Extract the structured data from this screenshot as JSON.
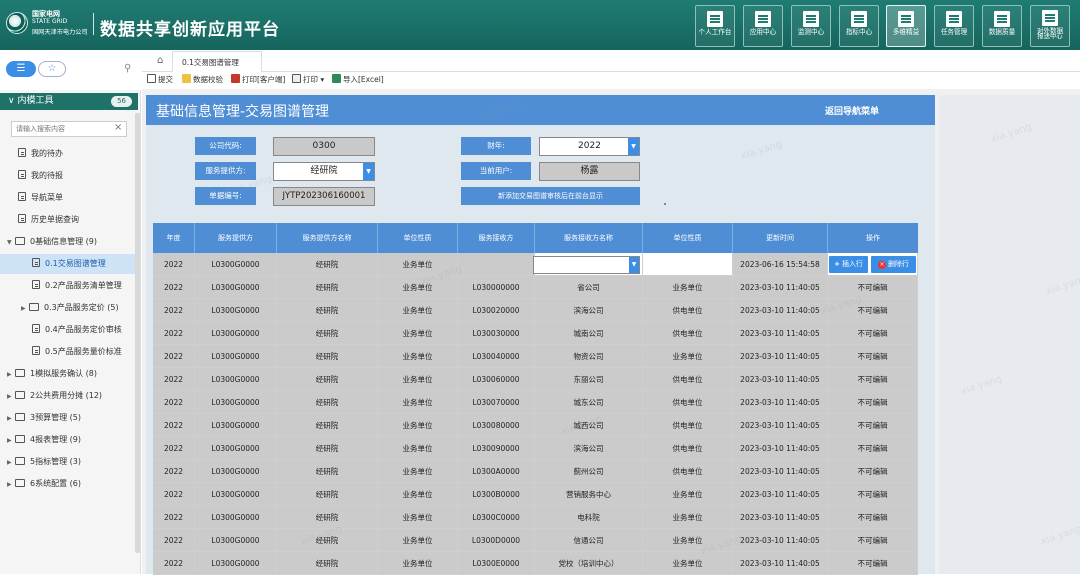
{
  "header": {
    "logo_line1": "国家电网",
    "logo_line2": "STATE GRID",
    "logo_line3": "国网天津市电力公司",
    "app_title": "数据共享创新应用平台",
    "nav": [
      {
        "label": "个人工作台"
      },
      {
        "label": "应用中心"
      },
      {
        "label": "监测中心"
      },
      {
        "label": "指标中心"
      },
      {
        "label": "多维精益",
        "active": true
      },
      {
        "label": "任务管理"
      },
      {
        "label": "数据质量"
      },
      {
        "label": "对外数据",
        "label2": "报送中心"
      }
    ]
  },
  "sidebar": {
    "section": "内模工具",
    "count": "56",
    "search_placeholder": "请输入搜索内容",
    "items": [
      {
        "label": "我的待办"
      },
      {
        "label": "我的待报"
      },
      {
        "label": "导航菜单"
      },
      {
        "label": "历史单据查询"
      },
      {
        "label": "0基础信息管理 (9)"
      },
      {
        "label": "0.1交易图谱管理",
        "selected": true
      },
      {
        "label": "0.2产品服务清单管理"
      },
      {
        "label": "0.3产品服务定价 (5)"
      },
      {
        "label": "0.4产品服务定价审核"
      },
      {
        "label": "0.5产品服务量价标准"
      },
      {
        "label": "1模拟服务确认 (8)"
      },
      {
        "label": "2公共费用分摊 (12)"
      },
      {
        "label": "3预算管理 (5)"
      },
      {
        "label": "4报表管理 (9)"
      },
      {
        "label": "5指标管理 (3)"
      },
      {
        "label": "6系统配置 (6)"
      }
    ]
  },
  "tabs": {
    "home_icon": "home-icon",
    "active_tab": "0.1交易图谱管理"
  },
  "toolbar": {
    "submit": "提交",
    "validate": "数据校验",
    "print_client": "打印[客户端]",
    "print": "打印",
    "import": "导入[Excel]"
  },
  "form": {
    "title": "基础信息管理-交易图谱管理",
    "back_label": "返回导航菜单",
    "company_code_label": "公司代码:",
    "company_code": "0300",
    "fiscal_year_label": "财年:",
    "fiscal_year": "2022",
    "provider_label": "服务提供方:",
    "provider": "经研院",
    "current_user_label": "当前用户:",
    "current_user": "杨露",
    "doc_no_label": "单据编号:",
    "doc_no": "JYTP202306160001",
    "notice": "新添加交易图谱审核后在前台显示"
  },
  "table": {
    "headers": [
      "年度",
      "服务提供方",
      "服务提供方名称",
      "单位性质",
      "服务接收方",
      "服务接收方名称",
      "单位性质",
      "更新时间",
      "操作"
    ],
    "insert_label": "插入行",
    "delete_label": "删除行",
    "rows": [
      [
        "2022",
        "L0300G0000",
        "经研院",
        "业务单位",
        "",
        "",
        "",
        "2023-06-16 15:54:58",
        ""
      ],
      [
        "2022",
        "L0300G0000",
        "经研院",
        "业务单位",
        "L030000000",
        "省公司",
        "业务单位",
        "2023-03-10 11:40:05",
        "不可编辑"
      ],
      [
        "2022",
        "L0300G0000",
        "经研院",
        "业务单位",
        "L030020000",
        "滨海公司",
        "供电单位",
        "2023-03-10 11:40:05",
        "不可编辑"
      ],
      [
        "2022",
        "L0300G0000",
        "经研院",
        "业务单位",
        "L030030000",
        "城南公司",
        "供电单位",
        "2023-03-10 11:40:05",
        "不可编辑"
      ],
      [
        "2022",
        "L0300G0000",
        "经研院",
        "业务单位",
        "L030040000",
        "物资公司",
        "业务单位",
        "2023-03-10 11:40:05",
        "不可编辑"
      ],
      [
        "2022",
        "L0300G0000",
        "经研院",
        "业务单位",
        "L030060000",
        "东丽公司",
        "供电单位",
        "2023-03-10 11:40:05",
        "不可编辑"
      ],
      [
        "2022",
        "L0300G0000",
        "经研院",
        "业务单位",
        "L030070000",
        "城东公司",
        "供电单位",
        "2023-03-10 11:40:05",
        "不可编辑"
      ],
      [
        "2022",
        "L0300G0000",
        "经研院",
        "业务单位",
        "L030080000",
        "城西公司",
        "供电单位",
        "2023-03-10 11:40:05",
        "不可编辑"
      ],
      [
        "2022",
        "L0300G0000",
        "经研院",
        "业务单位",
        "L030090000",
        "滨海公司",
        "供电单位",
        "2023-03-10 11:40:05",
        "不可编辑"
      ],
      [
        "2022",
        "L0300G0000",
        "经研院",
        "业务单位",
        "L0300A0000",
        "蓟州公司",
        "供电单位",
        "2023-03-10 11:40:05",
        "不可编辑"
      ],
      [
        "2022",
        "L0300G0000",
        "经研院",
        "业务单位",
        "L0300B0000",
        "营销服务中心",
        "业务单位",
        "2023-03-10 11:40:05",
        "不可编辑"
      ],
      [
        "2022",
        "L0300G0000",
        "经研院",
        "业务单位",
        "L0300C0000",
        "电科院",
        "业务单位",
        "2023-03-10 11:40:05",
        "不可编辑"
      ],
      [
        "2022",
        "L0300G0000",
        "经研院",
        "业务单位",
        "L0300D0000",
        "信通公司",
        "业务单位",
        "2023-03-10 11:40:05",
        "不可编辑"
      ],
      [
        "2022",
        "L0300G0000",
        "经研院",
        "业务单位",
        "L0300E0000",
        "党校（培训中心）",
        "业务单位",
        "2023-03-10 11:40:05",
        "不可编辑"
      ]
    ]
  },
  "watermark": "xia.yang",
  "colors": {
    "brand": "#1f7c73",
    "accent": "#4f8ed5",
    "button": "#3a8ee6"
  }
}
